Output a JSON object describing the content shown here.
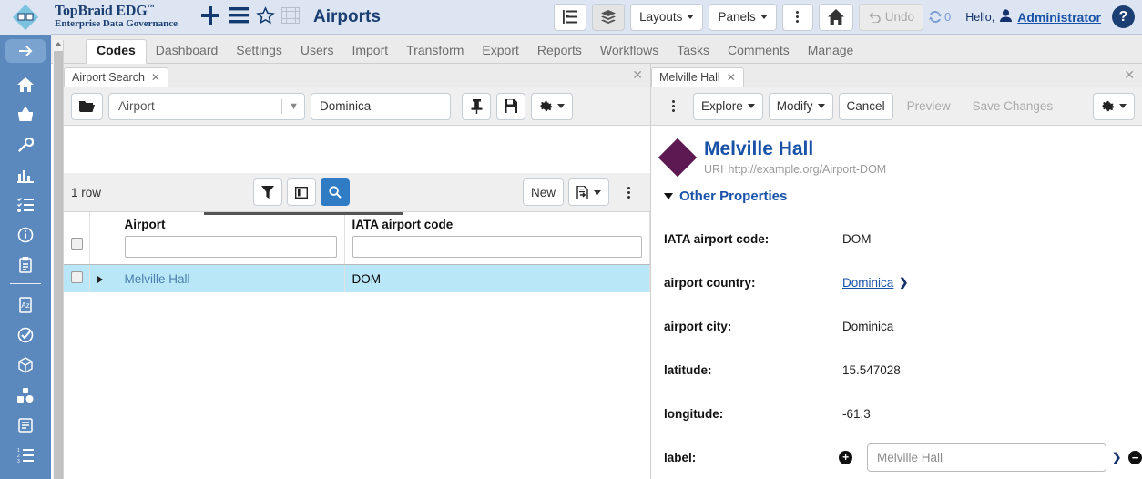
{
  "brand": {
    "title": "TopBraid EDG",
    "trademark": "™",
    "subtitle": "Enterprise Data Governance",
    "project": "Airports"
  },
  "header": {
    "icons": [
      "plus-icon",
      "hamburger-icon",
      "star-icon",
      "grid-icon"
    ],
    "buttons": {
      "outline_toggle": "outline-toggle-icon",
      "layers_toggle": "layers-toggle-icon",
      "layouts": "Layouts",
      "panels": "Panels",
      "more": "more-vertical-icon",
      "home": "home-icon",
      "undo": "Undo",
      "sync_count": "0"
    },
    "hello_text": "Hello,",
    "user": "Administrator",
    "help": "?"
  },
  "nav": {
    "tabs": [
      {
        "label": "Codes",
        "active": true
      },
      {
        "label": "Dashboard",
        "active": false
      },
      {
        "label": "Settings",
        "active": false
      },
      {
        "label": "Users",
        "active": false
      },
      {
        "label": "Import",
        "active": false
      },
      {
        "label": "Transform",
        "active": false
      },
      {
        "label": "Export",
        "active": false
      },
      {
        "label": "Reports",
        "active": false
      },
      {
        "label": "Workflows",
        "active": false
      },
      {
        "label": "Tasks",
        "active": false
      },
      {
        "label": "Comments",
        "active": false
      },
      {
        "label": "Manage",
        "active": false
      }
    ]
  },
  "sidebar": {
    "items": [
      {
        "name": "expand-arrow-icon",
        "active": true
      },
      {
        "name": "home-icon"
      },
      {
        "name": "basket-icon"
      },
      {
        "name": "wrench-icon"
      },
      {
        "name": "bar-chart-icon"
      },
      {
        "name": "checklist-icon"
      },
      {
        "name": "info-icon"
      },
      {
        "name": "clipboard-icon"
      },
      {
        "name": "glossary-az-icon"
      },
      {
        "name": "check-circle-icon"
      },
      {
        "name": "cube-icon"
      },
      {
        "name": "shapes-icon"
      },
      {
        "name": "document-icon"
      },
      {
        "name": "ordered-list-icon"
      }
    ]
  },
  "left_panel": {
    "tab": {
      "label": "Airport Search",
      "close": "✕"
    },
    "panel_close": "✕",
    "search_toolbar": {
      "open_icon": "folder-open-icon",
      "type_select": "Airport",
      "query_value": "Dominica",
      "pin_icon": "pin-icon",
      "save_icon": "save-icon",
      "gear_icon": "gear-icon"
    },
    "results_toolbar": {
      "row_count": "1 row",
      "filter_icon": "funnel-icon",
      "columns_icon": "columns-icon",
      "search_icon": "magnifier-icon",
      "new_label": "New",
      "export_icon": "export-file-icon",
      "more_icon": "more-vertical-icon"
    },
    "table": {
      "columns": [
        "Airport",
        "IATA airport code"
      ],
      "filters": [
        "",
        ""
      ],
      "rows": [
        {
          "selected": true,
          "airport": "Melville Hall",
          "iata": "DOM"
        }
      ]
    }
  },
  "right_panel": {
    "tab": {
      "label": "Melville Hall",
      "close": "✕"
    },
    "panel_close": "✕",
    "toolbar": {
      "more_icon": "more-vertical-icon",
      "explore": "Explore",
      "modify": "Modify",
      "cancel": "Cancel",
      "preview": "Preview",
      "save_changes": "Save Changes",
      "gear_icon": "gear-icon"
    },
    "resource": {
      "icon": "purple-diamond-icon",
      "title": "Melville Hall",
      "uri_label": "URI",
      "uri": "http://example.org/Airport-DOM"
    },
    "section": {
      "title": "Other Properties",
      "expanded": true
    },
    "properties": [
      {
        "label": "IATA airport code:",
        "value": "DOM",
        "type": "text"
      },
      {
        "label": "airport country:",
        "value": "Dominica",
        "type": "link"
      },
      {
        "label": "airport city:",
        "value": "Dominica",
        "type": "text"
      },
      {
        "label": "latitude:",
        "value": "15.547028",
        "type": "text"
      },
      {
        "label": "longitude:",
        "value": "-61.3",
        "type": "text"
      },
      {
        "label": "label:",
        "value": "Melville Hall",
        "type": "input"
      }
    ]
  },
  "colors": {
    "header_bg": "#dde5f2",
    "rail_bg": "#5b89bd",
    "brand_blue": "#1b3f73",
    "link_blue": "#1852a8",
    "selected_row": "#b9e7f8",
    "accent_button": "#2f7cc4",
    "diamond_purple": "#5d1a52"
  }
}
